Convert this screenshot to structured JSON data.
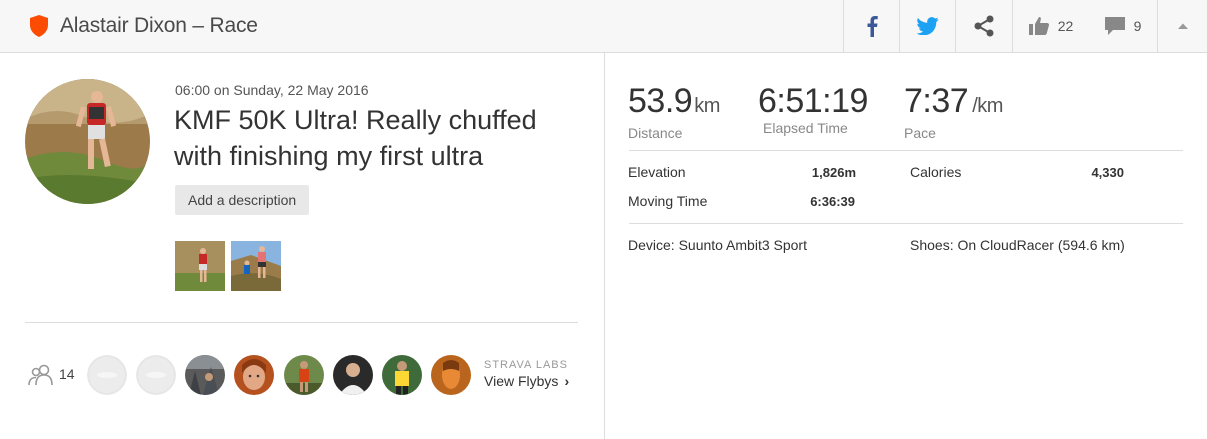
{
  "header": {
    "title": "Alastair Dixon – Race",
    "kudos_count": "22",
    "comments_count": "9"
  },
  "activity": {
    "datetime": "06:00 on Sunday, 22 May 2016",
    "title": "KMF 50K Ultra! Really chuffed with finishing my first ultra",
    "add_description_label": "Add a description"
  },
  "social": {
    "kudos_given": "14",
    "labs_label": "STRAVA LABS",
    "flyby_label": "View Flybys"
  },
  "stats": {
    "distance": {
      "value": "53.9",
      "unit": "km",
      "label": "Distance"
    },
    "elapsed": {
      "value": "6:51:19",
      "label": "Elapsed Time"
    },
    "pace": {
      "value": "7:37",
      "unit": "/km",
      "label": "Pace"
    },
    "elevation": {
      "label": "Elevation",
      "value": "1,826m"
    },
    "calories": {
      "label": "Calories",
      "value": "4,330"
    },
    "moving_time": {
      "label": "Moving Time",
      "value": "6:36:39"
    },
    "device": "Device: Suunto Ambit3 Sport",
    "shoes": "Shoes: On CloudRacer (594.6 km)"
  },
  "colors": {
    "brand": "#fc4c02",
    "facebook": "#3b5998",
    "twitter": "#1da1f2"
  }
}
